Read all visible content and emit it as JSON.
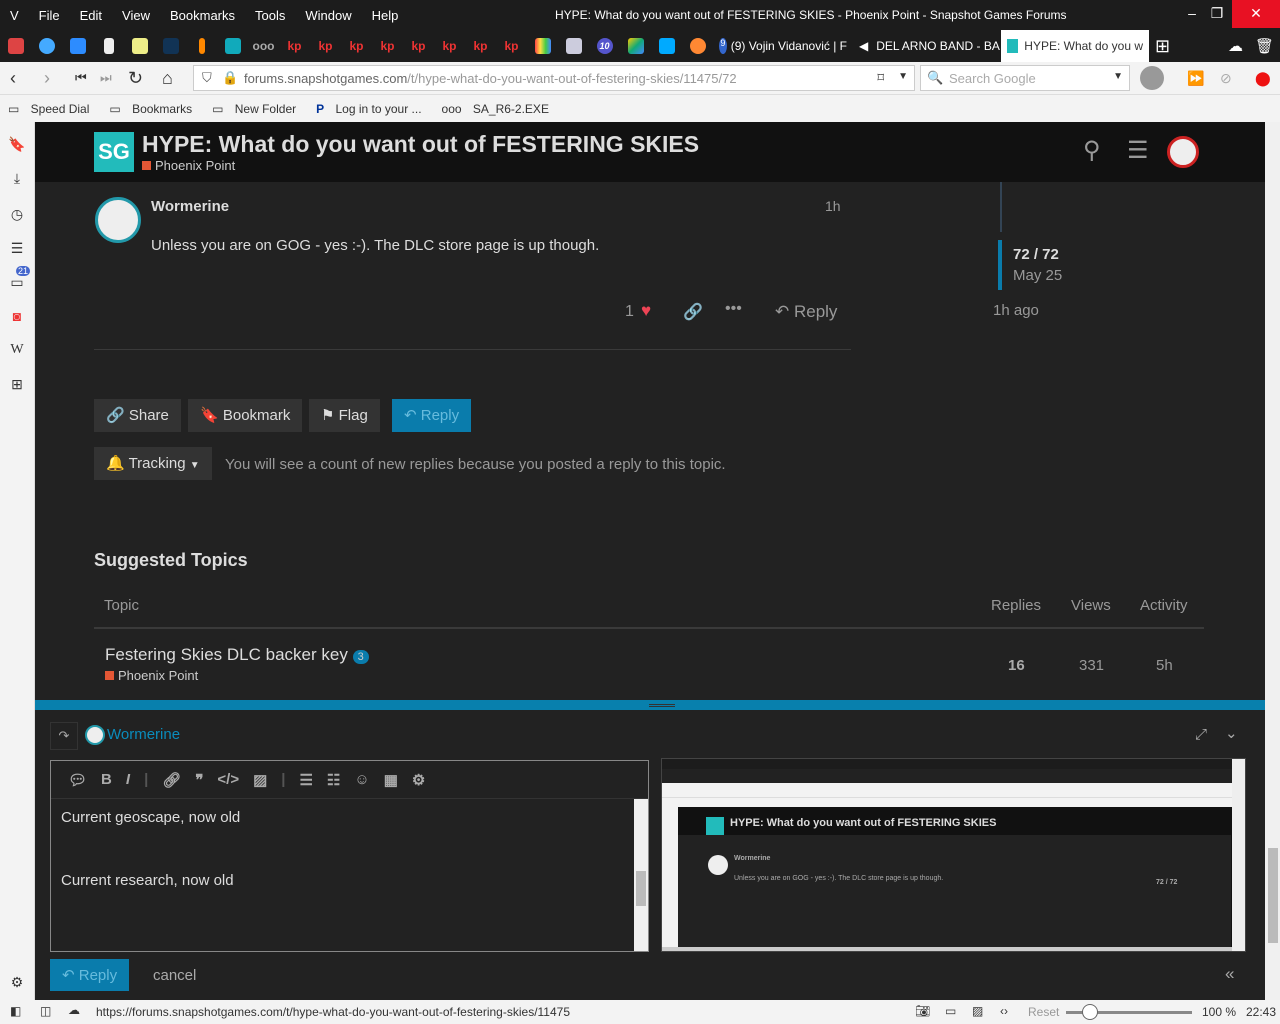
{
  "menu": [
    "File",
    "Edit",
    "View",
    "Bookmarks",
    "Tools",
    "Window",
    "Help"
  ],
  "window_title": "HYPE: What do you want out of FESTERING SKIES - Phoenix Point - Snapshot Games Forums",
  "tabs": [
    {
      "label": "(9) Vojin Vidanović | F"
    },
    {
      "label": "DEL ARNO BAND - BA"
    },
    {
      "label": "HYPE: What do you w"
    }
  ],
  "facebook_badge": "9",
  "calendar_badge": "10",
  "address": {
    "url_host": "forums.snapshotgames.com",
    "url_path": "/t/hype-what-do-you-want-out-of-festering-skies/11475/72",
    "search_placeholder": "Search Google"
  },
  "bookmarks": [
    "Speed Dial",
    "Bookmarks",
    "New Folder",
    "Log in to your ...",
    "SA_R6-2.EXE"
  ],
  "side_badge": "21",
  "header": {
    "title": "HYPE: What do you want out of FESTERING SKIES",
    "category": "Phoenix Point"
  },
  "post": {
    "author": "Wormerine",
    "age": "1h",
    "body": "Unless you are on GOG - yes :-). The DLC store page is up though.",
    "likes": "1",
    "reply": "Reply"
  },
  "timeline": {
    "position": "72 / 72",
    "date": "May 25",
    "ago": "1h ago"
  },
  "actions": {
    "share": "Share",
    "bookmark": "Bookmark",
    "flag": "Flag",
    "reply": "Reply"
  },
  "tracking": {
    "label": "Tracking",
    "text": "You will see a count of new replies because you posted a reply to this topic."
  },
  "suggested": {
    "title": "Suggested Topics",
    "headers": [
      "Topic",
      "Replies",
      "Views",
      "Activity"
    ],
    "rows": [
      {
        "title": "Festering Skies DLC backer key",
        "badge": "3",
        "category": "Phoenix Point",
        "replies": "16",
        "views": "331",
        "activity": "5h"
      }
    ]
  },
  "composer": {
    "user": "Wormerine",
    "lines": [
      "Current geoscape, now old",
      "Current research, now old"
    ],
    "reply": "Reply",
    "cancel": "cancel"
  },
  "status": {
    "url": "https://forums.snapshotgames.com/t/hype-what-do-you-want-out-of-festering-skies/11475",
    "reset": "Reset",
    "zoom": "100 %",
    "time": "22:43"
  }
}
